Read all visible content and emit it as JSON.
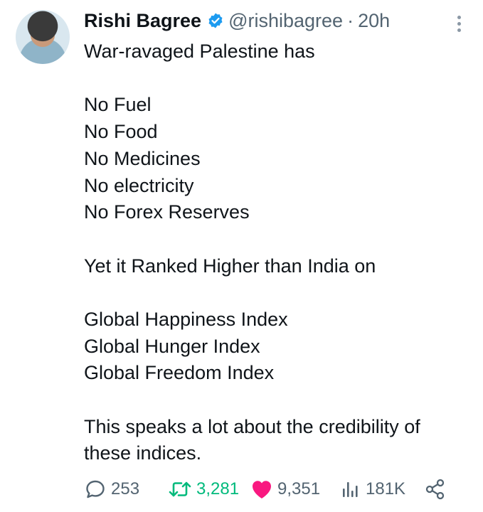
{
  "tweet": {
    "author_name": "Rishi Bagree",
    "handle": "@rishibagree",
    "separator": "·",
    "time": "20h",
    "lines": [
      "War-ravaged Palestine has",
      "",
      "No Fuel",
      "No Food",
      "No Medicines",
      "No electricity",
      "No Forex Reserves",
      "",
      "Yet it Ranked Higher than India on",
      "",
      "Global Happiness Index",
      "Global Hunger Index",
      "Global Freedom Index",
      "",
      "This speaks a lot about the credibility of",
      "these indices."
    ]
  },
  "actions": {
    "replies": "253",
    "retweets": "3,281",
    "likes": "9,351",
    "views": "181K"
  },
  "colors": {
    "verified": "#1d9bf0",
    "retweet": "#00ba7c",
    "like": "#f91880",
    "muted": "#536471"
  },
  "icons": [
    "verified-badge-icon",
    "more-options-icon",
    "reply-icon",
    "retweet-icon",
    "like-icon",
    "views-icon",
    "share-icon"
  ]
}
